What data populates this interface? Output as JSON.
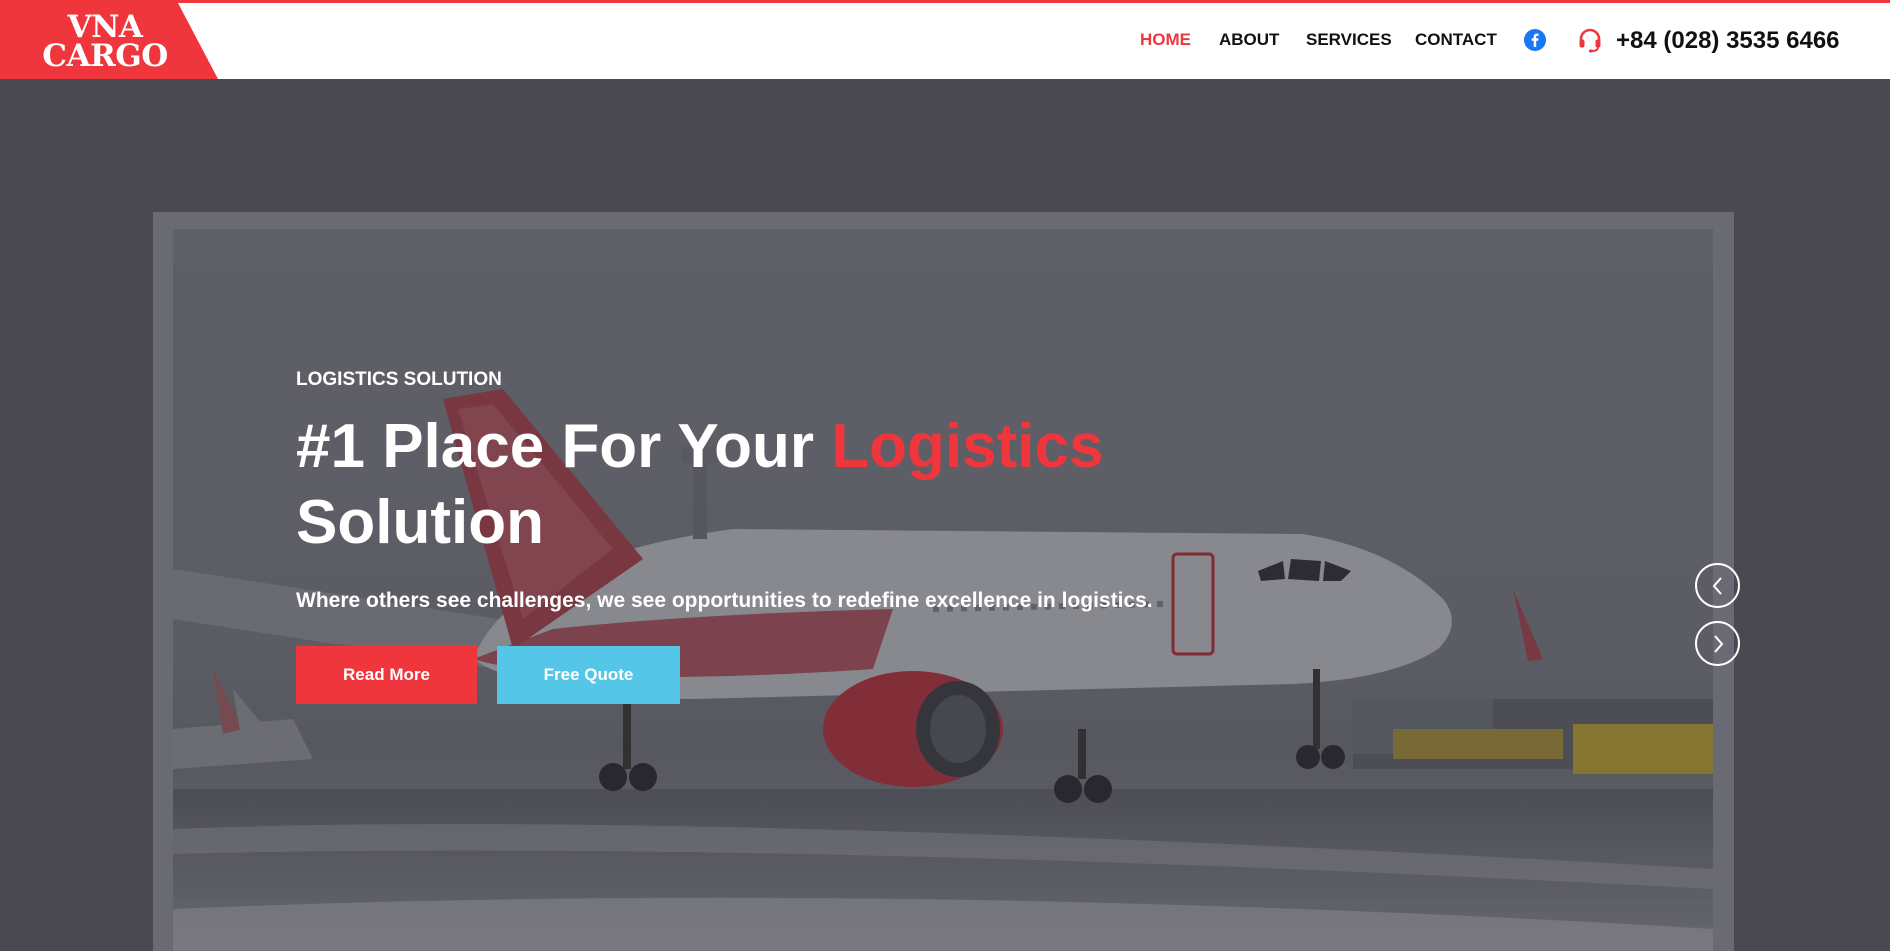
{
  "brand": {
    "logo_line1": "VNA",
    "logo_line2": "CARGO",
    "accent_color": "#f0363d",
    "secondary_color": "#55c6e8"
  },
  "nav": {
    "items": [
      {
        "label": "HOME",
        "active": true
      },
      {
        "label": "ABOUT",
        "active": false
      },
      {
        "label": "SERVICES",
        "active": false
      },
      {
        "label": "CONTACT",
        "active": false
      }
    ],
    "social_icon": "facebook-icon",
    "support_icon": "headset-icon",
    "phone": "+84 (028) 3535 6466"
  },
  "hero": {
    "eyebrow": "LOGISTICS SOLUTION",
    "headline_part1": "#1 Place For Your",
    "headline_accent": "Logistics",
    "headline_part2": "Solution",
    "subline": "Where others see challenges, we see opportunities to redefine excellence in logistics.",
    "read_more_label": "Read More",
    "free_quote_label": "Free Quote",
    "prev_icon": "chevron-left-icon",
    "next_icon": "chevron-right-icon"
  }
}
